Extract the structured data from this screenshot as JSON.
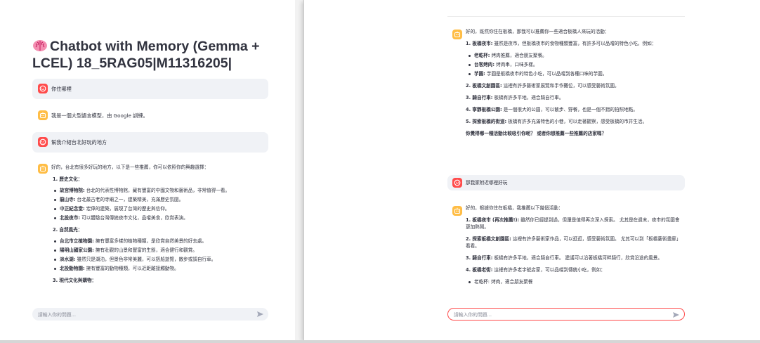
{
  "left": {
    "title": "Chatbot with Memory (Gemma + LCEL) 18_5RAG05|M11316205|",
    "messages": [
      {
        "role": "user",
        "text": "你住哪裡"
      },
      {
        "role": "bot",
        "text": "我是一個大型語言模型，由 Google 訓練。"
      },
      {
        "role": "user",
        "text": "幫我介紹台北好玩的地方"
      }
    ],
    "answer": {
      "intro": "好的，台北有很多好玩的地方，以下是一些推薦，你可以依照你的興趣選擇：",
      "sections": [
        {
          "heading": "1. 歷史文化：",
          "items": [
            {
              "name": "故宮博物院:",
              "desc": " 台北的代表性博物館，藏有豐富的中國文物和藝術品，非常值得一看。"
            },
            {
              "name": "龍山寺:",
              "desc": " 台北最古老的寺廟之一，建築精美，充滿歷史氛圍。"
            },
            {
              "name": "中正紀念堂:",
              "desc": " 宏偉的建築，展現了台灣的歷史與信仰。"
            },
            {
              "name": "北投夜市:",
              "desc": " 可以體驗台灣傳統夜市文化，品嚐美食，欣賞表演。"
            }
          ]
        },
        {
          "heading": "2. 自然風光：",
          "items": [
            {
              "name": "台北市立植物園:",
              "desc": " 擁有豐富多樣的植物種類，是欣賞自然美景的好去處。"
            },
            {
              "name": "陽明山國家公園:",
              "desc": " 擁有壯觀的山景和豐富的生態，適合健行和觀賞。"
            },
            {
              "name": "淡水湖:",
              "desc": " 雖然只是湖泊，但景色非常美麗，可以搭船遊覽，散步或調自行車。"
            },
            {
              "name": "北投動物園:",
              "desc": " 擁有豐富的動物種類，可以近距離接觸動物。"
            }
          ]
        },
        {
          "heading": "3. 現代文化與購物：",
          "items": []
        }
      ]
    },
    "input_placeholder": "請輸入你的問題..."
  },
  "right": {
    "answer1": {
      "intro": "好的，既然你住在板橋，那我可以推薦你一些適合板橋人來玩的活動：",
      "items": [
        {
          "name": "1. 板橋夜市:",
          "desc": " 雖然是夜市，但板橋夜市的食物種類豐富，有許多可以品嚐的特色小吃，例如："
        },
        {
          "name": "2. 板橋文創園區:",
          "desc": " 這裡有許多藝術家展覽和手作攤位，可以感受藝術氛圍。"
        },
        {
          "name": "3. 騎自行車:",
          "desc": " 板橋有許多平地，適合騎自行車。"
        },
        {
          "name": "4. 寧靜板橋公園:",
          "desc": " 是一個很大的公園，可以散步、野餐，也是一個不錯的拍照地點。"
        },
        {
          "name": "5. 探索板橋的街道:",
          "desc": " 板橋有許多充滿特色的小巷，可以走著觀察，感受板橋的市井生活。"
        }
      ],
      "bullets": [
        {
          "name": "老乾杯:",
          "desc": " 烤肉推薦，適合朋友聚餐。"
        },
        {
          "name": "台客烤肉:",
          "desc": " 烤肉串，口味多樣。"
        },
        {
          "name": "芋圓:",
          "desc": " 芋圓是板橋夜市的特色小吃，可以品嚐到各種口味的芋圓。"
        }
      ],
      "question": "你覺得哪一種活動比較吸引你呢？ 或者你想推薦一些推薦的店家嗎？"
    },
    "user_message": "那我家附近哪裡好玩",
    "answer2": {
      "intro": "好的，根據你住在板橋，我推薦以下幾個活動：",
      "items": [
        {
          "name": "1. 板橋夜市 (再次推薦!):",
          "desc": " 雖然你已經提到過，但還是值得再次深入探索。 尤其是在週末，夜市的氛圍會更加熱鬧。"
        },
        {
          "name": "2. 探索板橋文創園區:",
          "desc": " 這裡有許多藝術家作品，可以逛逛，感受藝術氛圍。 尤其可以到「板橋藝術畫廊」看看。"
        },
        {
          "name": "3. 騎自行車:",
          "desc": " 板橋有許多平地，適合騎自行車。 建議可以沿著板橋河畔騎行，欣賞沿途的風景。"
        },
        {
          "name": "4. 板橋老街:",
          "desc": " 這裡有許多老字號店家，可以品嚐到傳統小吃，例如："
        }
      ],
      "cutoff": "老乾杯: 烤肉，適合朋友聚餐"
    },
    "input_placeholder": "請輸入你的問題..."
  },
  "colors": {
    "user_avatar": "#ff4b4b",
    "bot_avatar": "#ffbd45",
    "focus_border": "#ff4b4b"
  }
}
